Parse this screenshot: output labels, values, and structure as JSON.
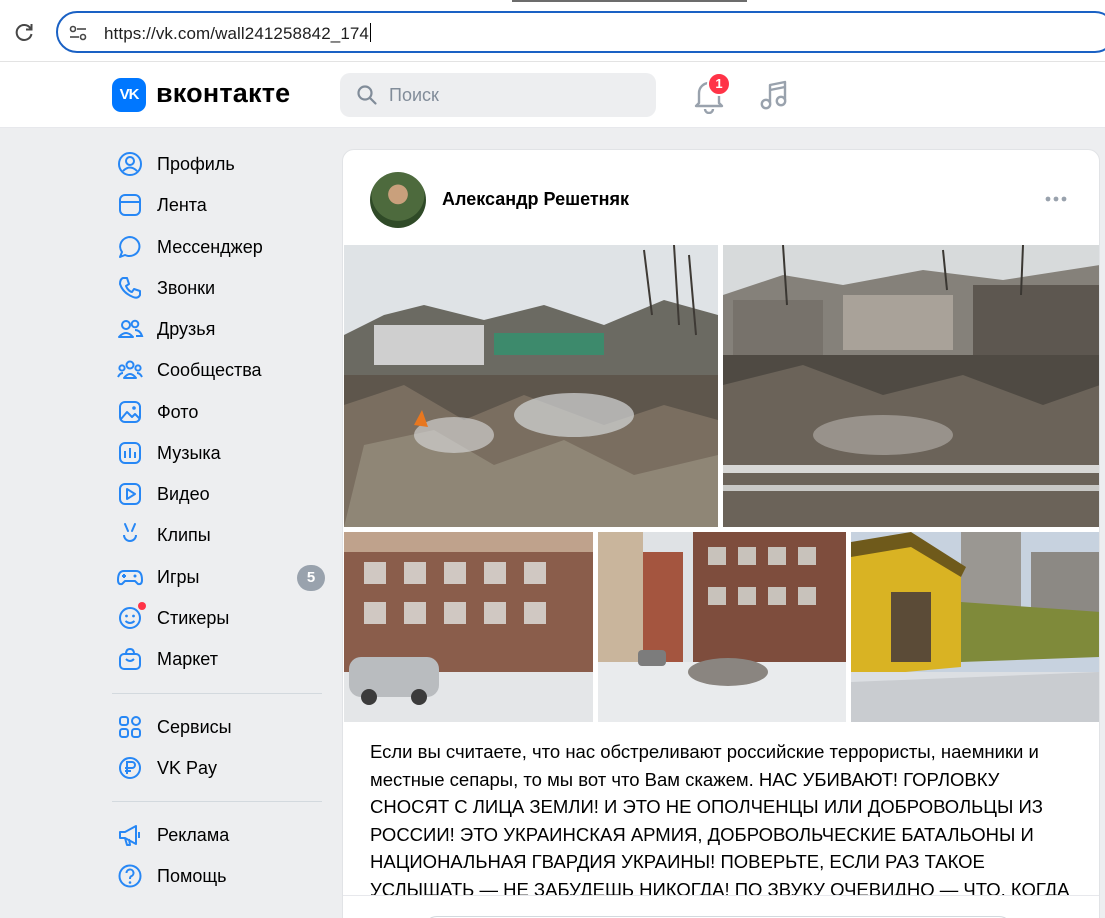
{
  "browser": {
    "url": "https://vk.com/wall241258842_174"
  },
  "header": {
    "logo_text": "VK",
    "brand": "вконтакте",
    "search_placeholder": "Поиск",
    "notifications_count": "1",
    "accent_color": "#0077ff"
  },
  "menu": {
    "items": [
      {
        "label": "Профиль",
        "icon": "user-circle-icon"
      },
      {
        "label": "Лента",
        "icon": "news-feed-icon"
      },
      {
        "label": "Мессенджер",
        "icon": "chat-bubble-icon"
      },
      {
        "label": "Звонки",
        "icon": "phone-icon"
      },
      {
        "label": "Друзья",
        "icon": "friends-icon"
      },
      {
        "label": "Сообщества",
        "icon": "communities-icon"
      },
      {
        "label": "Фото",
        "icon": "photo-icon"
      },
      {
        "label": "Музыка",
        "icon": "music-waveform-icon"
      },
      {
        "label": "Видео",
        "icon": "video-play-icon"
      },
      {
        "label": "Клипы",
        "icon": "clips-icon"
      },
      {
        "label": "Игры",
        "icon": "gamepad-icon",
        "count": "5"
      },
      {
        "label": "Стикеры",
        "icon": "smiley-icon"
      },
      {
        "label": "Маркет",
        "icon": "shopping-bag-icon"
      }
    ],
    "extra": [
      {
        "label": "Сервисы",
        "icon": "services-grid-icon"
      },
      {
        "label": "VK Pay",
        "icon": "vk-pay-icon"
      }
    ],
    "footer": [
      {
        "label": "Реклама",
        "icon": "megaphone-icon"
      },
      {
        "label": "Помощь",
        "icon": "help-icon"
      }
    ]
  },
  "post": {
    "author": "Александр Решетняк",
    "text": "Если вы считаете, что нас обстреливают российские террористы, наемники и местные сепары, то мы вот что Вам скажем. НАС УБИВАЮТ! ГОРЛОВКУ СНОСЯТ С ЛИЦА ЗЕМЛИ! И ЭТО НЕ ОПОЛЧЕНЦЫ ИЛИ ДОБРОВОЛЬЦЫ ИЗ РОССИИ! ЭТО УКРАИНСКАЯ АРМИЯ, ДОБРОВОЛЬЧЕСКИЕ БАТАЛЬОНЫ И НАЦИОНАЛЬНАЯ ГВАРДИЯ УКРАИНЫ! ПОВЕРЬТЕ, ЕСЛИ РАЗ ТАКОЕ УСЛЫШАТЬ — НЕ ЗАБУДЕШЬ НИКОГДА! ПО ЗВУКУ ОЧЕВИДНО — ЧТО, КОГДА"
  }
}
